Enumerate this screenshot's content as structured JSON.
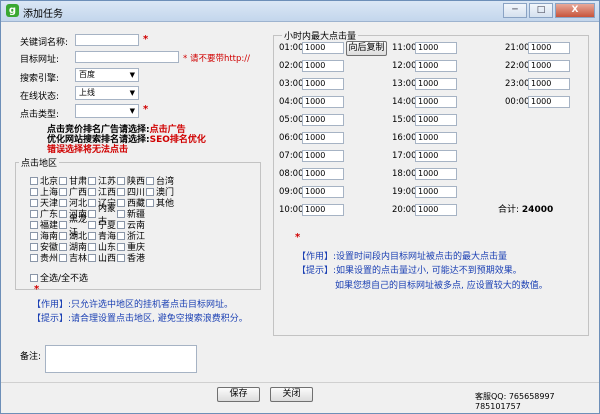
{
  "window": {
    "icon_glyph": "g",
    "title": "添加任务",
    "controls": [
      "─",
      "□",
      "X"
    ]
  },
  "form": {
    "keyword_label": "关键词名称:",
    "target_url_label": "目标网址:",
    "target_url_hint": "* 请不要带http://",
    "search_engine_label": "搜索引擎:",
    "search_engine_value": "百度",
    "online_status_label": "在线状态:",
    "online_status_value": "上线",
    "click_type_label": "点击类型:",
    "click_type_value": "",
    "required_mark": "*",
    "hint1_a": "点击竞价排名广告请选择:",
    "hint1_b": "点击广告",
    "hint2_a": "优化网站搜索排名请选择:",
    "hint2_b": "SEO排名优化",
    "hint3": "错误选择将无法点击"
  },
  "regions": {
    "title": "点击地区",
    "items": [
      "北京",
      "甘肃",
      "江苏",
      "陕西",
      "台湾",
      "上海",
      "广西",
      "江西",
      "四川",
      "澳门",
      "天津",
      "河北",
      "辽宁",
      "西藏",
      "其他",
      "广东",
      "河南",
      "内蒙古",
      "新疆",
      "福建",
      "黑龙江",
      "宁夏",
      "云南",
      "海南",
      "湖北",
      "青海",
      "浙江",
      "安徽",
      "湖南",
      "山东",
      "重庆",
      "贵州",
      "吉林",
      "山西",
      "香港"
    ],
    "select_all_label": "全选/全不选",
    "star": "*",
    "note1_tag": "【作用】:",
    "note1_text": "只允许选中地区的挂机者点击目标网址。",
    "note2_tag": "【提示】:",
    "note2_text": "请合理设置点击地区, 避免空搜索浪费积分。"
  },
  "hourly": {
    "title": "小时内最大点击量",
    "copy_button": "向后复制",
    "hours": [
      {
        "label": "01:00",
        "value": "1000"
      },
      {
        "label": "02:00",
        "value": "1000"
      },
      {
        "label": "03:00",
        "value": "1000"
      },
      {
        "label": "04:00",
        "value": "1000"
      },
      {
        "label": "05:00",
        "value": "1000"
      },
      {
        "label": "06:00",
        "value": "1000"
      },
      {
        "label": "07:00",
        "value": "1000"
      },
      {
        "label": "08:00",
        "value": "1000"
      },
      {
        "label": "09:00",
        "value": "1000"
      },
      {
        "label": "10:00",
        "value": "1000"
      },
      {
        "label": "11:00",
        "value": "1000"
      },
      {
        "label": "12:00",
        "value": "1000"
      },
      {
        "label": "13:00",
        "value": "1000"
      },
      {
        "label": "14:00",
        "value": "1000"
      },
      {
        "label": "15:00",
        "value": "1000"
      },
      {
        "label": "16:00",
        "value": "1000"
      },
      {
        "label": "17:00",
        "value": "1000"
      },
      {
        "label": "18:00",
        "value": "1000"
      },
      {
        "label": "19:00",
        "value": "1000"
      },
      {
        "label": "20:00",
        "value": "1000"
      },
      {
        "label": "21:00",
        "value": "1000"
      },
      {
        "label": "22:00",
        "value": "1000"
      },
      {
        "label": "23:00",
        "value": "1000"
      },
      {
        "label": "00:00",
        "value": "1000"
      }
    ],
    "total_label": "合计:",
    "total_value": "24000",
    "star": "*",
    "note1_tag": "【作用】:",
    "note1_text": "设置时间段内目标网址被点击的最大点击量",
    "note2_tag": "【提示】:",
    "note2_text": "如果设置的点击量过小, 可能达不到预期效果。",
    "note3_text": "如果您想自己的目标网址被多点, 应设置较大的数值。"
  },
  "remark_label": "备注:",
  "buttons": {
    "save": "保存",
    "close": "关闭"
  },
  "support_qq": "客服QQ: 765658997  785101757"
}
